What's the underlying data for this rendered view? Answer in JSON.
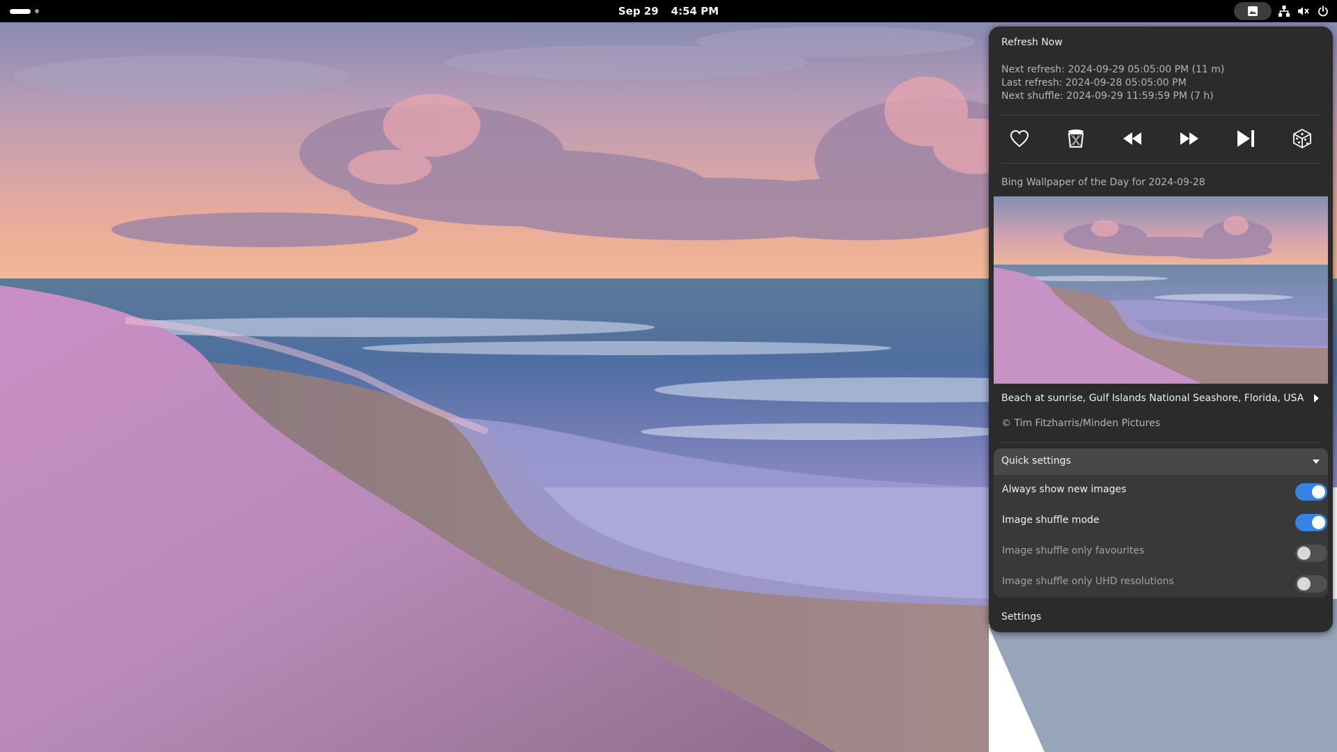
{
  "topbar": {
    "date": "Sep 29",
    "time": "4:54 PM",
    "icons": [
      "activities-indicator",
      "bing-wallpaper-icon",
      "network-icon",
      "volume-muted-icon",
      "power-icon"
    ]
  },
  "menu": {
    "refresh_now": "Refresh Now",
    "next_refresh": "Next refresh: 2024-09-29 05:05:00 PM (11 m)",
    "last_refresh": "Last refresh: 2024-09-28 05:05:00 PM",
    "next_shuffle": "Next shuffle: 2024-09-29 11:59:59 PM (7 h)",
    "controls": [
      "favourite-icon",
      "trash-icon",
      "previous-icon",
      "next-icon",
      "current-image-icon",
      "random-icon"
    ],
    "wallpaper_title": "Bing Wallpaper of the Day for 2024-09-28",
    "caption": "Beach at sunrise, Gulf Islands National Seashore, Florida, USA",
    "copyright": "© Tim Fitzharris/Minden Pictures",
    "settings": "Settings"
  },
  "quick_settings": {
    "header": "Quick settings",
    "rows": [
      {
        "label": "Always show new images",
        "enabled": true
      },
      {
        "label": "Image shuffle mode",
        "enabled": true
      },
      {
        "label": "Image shuffle only favourites",
        "enabled": false
      },
      {
        "label": "Image shuffle only UHD resolutions",
        "enabled": false
      }
    ]
  },
  "colors": {
    "accent": "#3584e4",
    "panel": "#2b2b2b",
    "topbar": "#000000"
  }
}
